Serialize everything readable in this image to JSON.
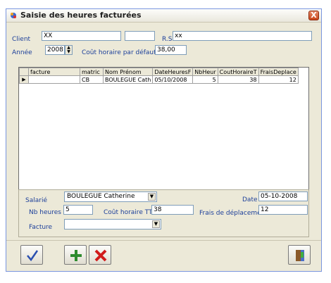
{
  "window": {
    "title": "Saisie des heures facturées",
    "close_label": "X"
  },
  "header": {
    "client_label": "Client",
    "client_value": "XX",
    "client_value2": "",
    "rs_label": "R.S.",
    "rs_value": "xx",
    "annee_label": "Année",
    "annee_value": "2008",
    "cout_label": "Coût horaire par défaut",
    "cout_value": "38,00"
  },
  "grid": {
    "columns": [
      "facture",
      "matric",
      "Nom Prénom",
      "DateHeuresF",
      "NbHeur",
      "CoutHoraireT",
      "FraisDeplace"
    ],
    "rows": [
      {
        "facture": "",
        "matric": "CB",
        "nom": "BOULEGUE Cath",
        "date": "05/10/2008",
        "nb": "5",
        "cout": "38",
        "frais": "12"
      }
    ],
    "row_indicator": "▶"
  },
  "form": {
    "salarie_label": "Salarié",
    "salarie_value": "BOULEGUE Catherine",
    "date_label": "Date",
    "date_value": "05-10-2008",
    "nb_label": "Nb heures",
    "nb_value": "5",
    "cout_ttc_label": "Coût horaire TTC",
    "cout_ttc_value": "38",
    "frais_label": "Frais de déplacement",
    "frais_value": "12",
    "facture_label": "Facture",
    "facture_value": ""
  },
  "icons": {
    "validate": "checkmark-icon",
    "add": "plus-icon",
    "delete": "cross-icon",
    "exit": "door-icon"
  },
  "colors": {
    "label_blue": "#1c3f9a",
    "add_green": "#2e8b2e",
    "delete_red": "#d11a1a"
  }
}
